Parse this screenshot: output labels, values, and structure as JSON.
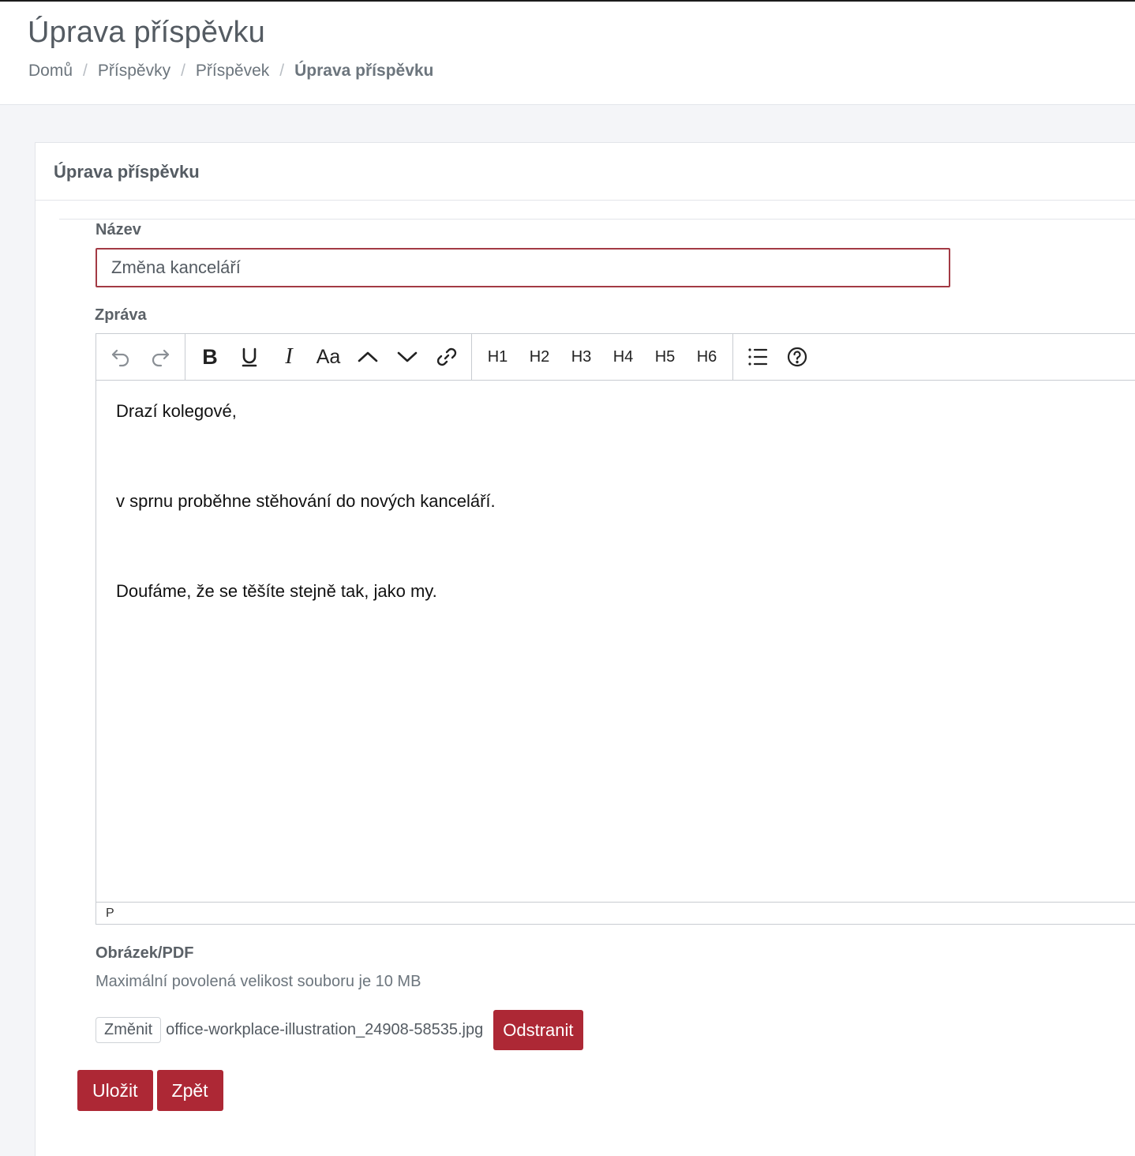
{
  "page": {
    "title": "Úprava příspěvku",
    "breadcrumb": [
      {
        "label": "Domů"
      },
      {
        "label": "Příspěvky"
      },
      {
        "label": "Příspěvek"
      },
      {
        "label": "Úprava příspěvku"
      }
    ],
    "breadcrumb_separator": "/"
  },
  "card": {
    "title": "Úprava příspěvku"
  },
  "form": {
    "name_label": "Název",
    "name_value": "Změna kanceláří",
    "message_label": "Zpráva",
    "attachment_label": "Obrázek/PDF",
    "attachment_help": "Maximální povolená velikost souboru je 10 MB",
    "change_button": "Změnit",
    "file_name": "office-workplace-illustration_24908-58535.jpg",
    "remove_button": "Odstranit",
    "save_button": "Uložit",
    "back_button": "Zpět"
  },
  "editor": {
    "toolbar": {
      "history": [
        "undo-icon",
        "redo-icon"
      ],
      "format": {
        "bold": "B",
        "underline": "U",
        "italic": "I",
        "font_size": "Aa",
        "chevron_up": "chevron-up-icon",
        "chevron_down": "chevron-down-icon",
        "link": "link-icon"
      },
      "headings": [
        "H1",
        "H2",
        "H3",
        "H4",
        "H5",
        "H6"
      ],
      "extra": [
        "list-icon",
        "help-icon"
      ]
    },
    "paragraphs": [
      "Drazí kolegové,",
      "v sprnu proběhne stěhování do nových kanceláří.",
      "Doufáme, že se těšíte stejně tak, jako my."
    ],
    "status_path": "P"
  },
  "colors": {
    "accent": "#ad2835",
    "input_border": "#a33a44",
    "muted_text": "#6c757d"
  }
}
